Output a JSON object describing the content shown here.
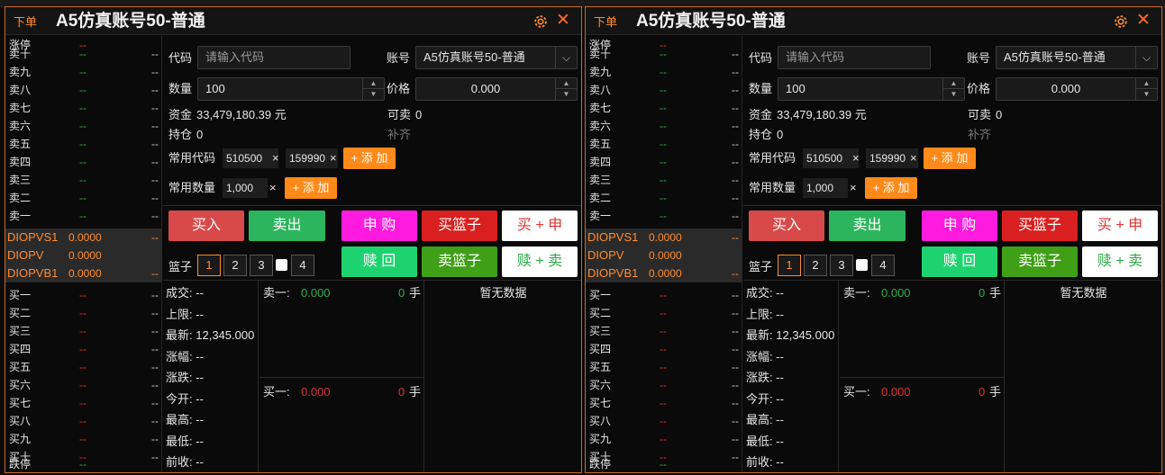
{
  "panels": [
    {
      "tag": "下单",
      "title": "A5仿真账号50-普通",
      "book": {
        "limit_up": {
          "label": "涨停",
          "price": "--"
        },
        "asks": [
          {
            "label": "卖十",
            "price": "--",
            "vol": "--"
          },
          {
            "label": "卖九",
            "price": "--",
            "vol": "--"
          },
          {
            "label": "卖八",
            "price": "--",
            "vol": "--"
          },
          {
            "label": "卖七",
            "price": "--",
            "vol": "--"
          },
          {
            "label": "卖六",
            "price": "--",
            "vol": "--"
          },
          {
            "label": "卖五",
            "price": "--",
            "vol": "--"
          },
          {
            "label": "卖四",
            "price": "--",
            "vol": "--"
          },
          {
            "label": "卖三",
            "price": "--",
            "vol": "--"
          },
          {
            "label": "卖二",
            "price": "--",
            "vol": "--"
          },
          {
            "label": "卖一",
            "price": "--",
            "vol": "--"
          }
        ],
        "mid": [
          {
            "label": "DIOPVS1",
            "value": "0.0000",
            "dash": "--"
          },
          {
            "label": "DIOPV",
            "value": "0.0000",
            "dash": ""
          },
          {
            "label": "DIOPVB1",
            "value": "0.0000",
            "dash": "--"
          }
        ],
        "bids": [
          {
            "label": "买一",
            "price": "--",
            "vol": "--"
          },
          {
            "label": "买二",
            "price": "--",
            "vol": "--"
          },
          {
            "label": "买三",
            "price": "--",
            "vol": "--"
          },
          {
            "label": "买四",
            "price": "--",
            "vol": "--"
          },
          {
            "label": "买五",
            "price": "--",
            "vol": "--"
          },
          {
            "label": "买六",
            "price": "--",
            "vol": "--"
          },
          {
            "label": "买七",
            "price": "--",
            "vol": "--"
          },
          {
            "label": "买八",
            "price": "--",
            "vol": "--"
          },
          {
            "label": "买九",
            "price": "--",
            "vol": "--"
          },
          {
            "label": "买十",
            "price": "--",
            "vol": "--"
          }
        ],
        "limit_down": {
          "label": "跌停",
          "price": "--"
        }
      },
      "form": {
        "code_label": "代码",
        "code_placeholder": "请输入代码",
        "account_label": "账号",
        "account_value": "A5仿真账号50-普通",
        "qty_label": "数量",
        "qty_value": "100",
        "price_label": "价格",
        "price_value": "0.000",
        "funds_label": "资金",
        "funds_value": "33,479,180.39 元",
        "sellable_label": "可卖",
        "sellable_value": "0",
        "position_label": "持仓",
        "position_value": "0",
        "fill_label": "补齐",
        "common_code_label": "常用代码",
        "common_codes": [
          "510500",
          "159990"
        ],
        "add_label": "+ 添 加",
        "common_qty_label": "常用数量",
        "common_qtys": [
          "1,000"
        ],
        "remove_glyph": "×"
      },
      "actions": {
        "buy": "买入",
        "sell": "卖出",
        "subscribe": "申 购",
        "buy_basket": "买篮子",
        "buy_sub": "买 + 申",
        "redeem": "赎 回",
        "sell_basket": "卖篮子",
        "redeem_sell": "赎 + 卖"
      },
      "basket": {
        "label": "篮子",
        "options": [
          "1",
          "2",
          "3",
          "4"
        ],
        "selected": "1"
      },
      "info": [
        {
          "label": "成交:",
          "value": "--"
        },
        {
          "label": "上限:",
          "value": "--"
        },
        {
          "label": "最新:",
          "value": "12,345.000"
        },
        {
          "label": "涨幅:",
          "value": "--"
        },
        {
          "label": "涨跌:",
          "value": "--"
        },
        {
          "label": "今开:",
          "value": "--"
        },
        {
          "label": "最高:",
          "value": "--"
        },
        {
          "label": "最低:",
          "value": "--"
        },
        {
          "label": "前收:",
          "value": "--"
        }
      ],
      "quote": {
        "ask_label": "卖一:",
        "ask_price": "0.000",
        "ask_vol": "0",
        "ask_unit": "手",
        "bid_label": "买一:",
        "bid_price": "0.000",
        "bid_vol": "0",
        "bid_unit": "手"
      },
      "nodata": "暂无数据"
    },
    {
      "tag": "下单",
      "title": "A5仿真账号50-普通",
      "book": {
        "limit_up": {
          "label": "涨停",
          "price": "--"
        },
        "asks": [
          {
            "label": "卖十",
            "price": "--",
            "vol": "--"
          },
          {
            "label": "卖九",
            "price": "--",
            "vol": "--"
          },
          {
            "label": "卖八",
            "price": "--",
            "vol": "--"
          },
          {
            "label": "卖七",
            "price": "--",
            "vol": "--"
          },
          {
            "label": "卖六",
            "price": "--",
            "vol": "--"
          },
          {
            "label": "卖五",
            "price": "--",
            "vol": "--"
          },
          {
            "label": "卖四",
            "price": "--",
            "vol": "--"
          },
          {
            "label": "卖三",
            "price": "--",
            "vol": "--"
          },
          {
            "label": "卖二",
            "price": "--",
            "vol": "--"
          },
          {
            "label": "卖一",
            "price": "--",
            "vol": "--"
          }
        ],
        "mid": [
          {
            "label": "DIOPVS1",
            "value": "0.0000",
            "dash": "--"
          },
          {
            "label": "DIOPV",
            "value": "0.0000",
            "dash": ""
          },
          {
            "label": "DIOPVB1",
            "value": "0.0000",
            "dash": "--"
          }
        ],
        "bids": [
          {
            "label": "买一",
            "price": "--",
            "vol": "--"
          },
          {
            "label": "买二",
            "price": "--",
            "vol": "--"
          },
          {
            "label": "买三",
            "price": "--",
            "vol": "--"
          },
          {
            "label": "买四",
            "price": "--",
            "vol": "--"
          },
          {
            "label": "买五",
            "price": "--",
            "vol": "--"
          },
          {
            "label": "买六",
            "price": "--",
            "vol": "--"
          },
          {
            "label": "买七",
            "price": "--",
            "vol": "--"
          },
          {
            "label": "买八",
            "price": "--",
            "vol": "--"
          },
          {
            "label": "买九",
            "price": "--",
            "vol": "--"
          },
          {
            "label": "买十",
            "price": "--",
            "vol": "--"
          }
        ],
        "limit_down": {
          "label": "跌停",
          "price": "--"
        }
      },
      "form": {
        "code_label": "代码",
        "code_placeholder": "请输入代码",
        "account_label": "账号",
        "account_value": "A5仿真账号50-普通",
        "qty_label": "数量",
        "qty_value": "100",
        "price_label": "价格",
        "price_value": "0.000",
        "funds_label": "资金",
        "funds_value": "33,479,180.39 元",
        "sellable_label": "可卖",
        "sellable_value": "0",
        "position_label": "持仓",
        "position_value": "0",
        "fill_label": "补齐",
        "common_code_label": "常用代码",
        "common_codes": [
          "510500",
          "159990"
        ],
        "add_label": "+ 添 加",
        "common_qty_label": "常用数量",
        "common_qtys": [
          "1,000"
        ],
        "remove_glyph": "×"
      },
      "actions": {
        "buy": "买入",
        "sell": "卖出",
        "subscribe": "申 购",
        "buy_basket": "买篮子",
        "buy_sub": "买 + 申",
        "redeem": "赎 回",
        "sell_basket": "卖篮子",
        "redeem_sell": "赎 + 卖"
      },
      "basket": {
        "label": "篮子",
        "options": [
          "1",
          "2",
          "3",
          "4"
        ],
        "selected": "1"
      },
      "info": [
        {
          "label": "成交:",
          "value": "--"
        },
        {
          "label": "上限:",
          "value": "--"
        },
        {
          "label": "最新:",
          "value": "12,345.000"
        },
        {
          "label": "涨幅:",
          "value": "--"
        },
        {
          "label": "涨跌:",
          "value": "--"
        },
        {
          "label": "今开:",
          "value": "--"
        },
        {
          "label": "最高:",
          "value": "--"
        },
        {
          "label": "最低:",
          "value": "--"
        },
        {
          "label": "前收:",
          "value": "--"
        }
      ],
      "quote": {
        "ask_label": "卖一:",
        "ask_price": "0.000",
        "ask_vol": "0",
        "ask_unit": "手",
        "bid_label": "买一:",
        "bid_price": "0.000",
        "bid_vol": "0",
        "bid_unit": "手"
      },
      "nodata": "暂无数据"
    }
  ],
  "colors": {
    "accent": "#ff8c33",
    "border": "#c96a2b",
    "ask_price": "#2fb04a",
    "bid_price": "#e03232"
  }
}
